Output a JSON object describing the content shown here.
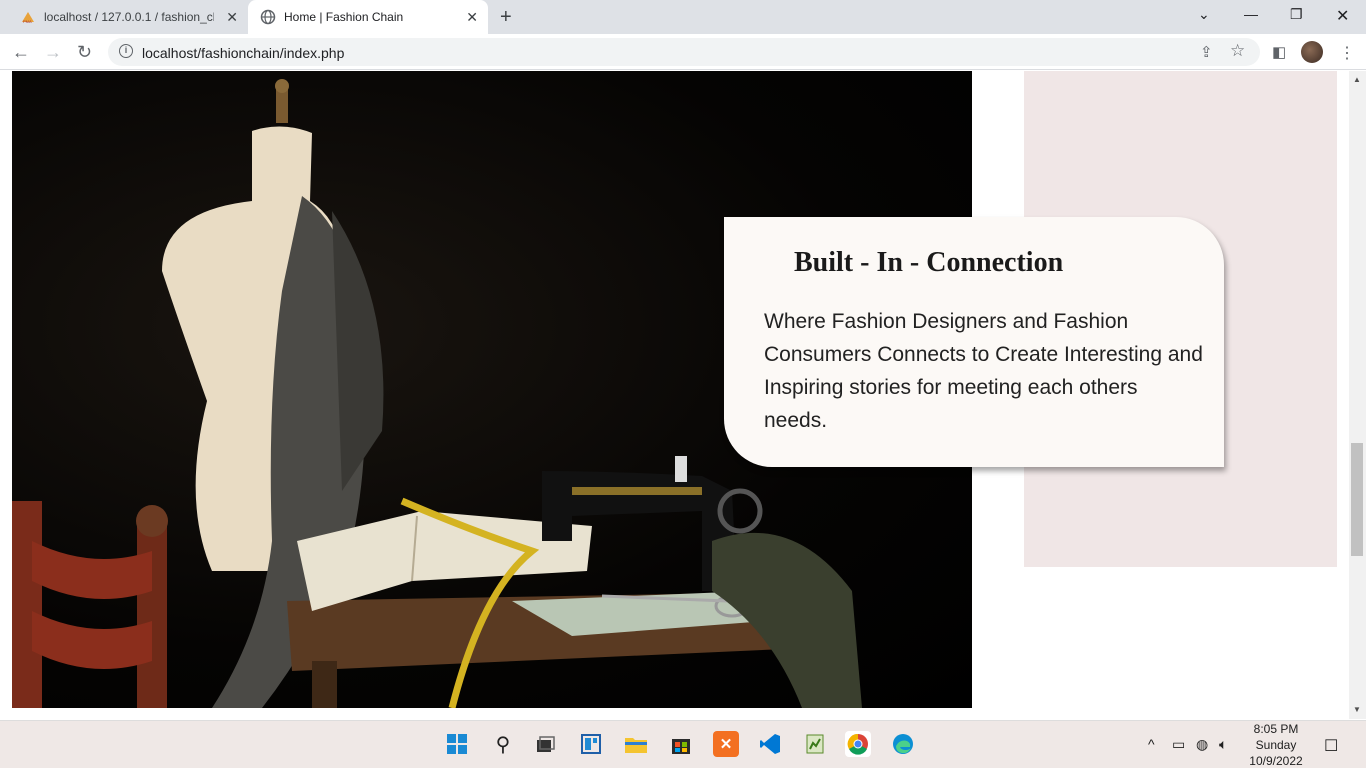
{
  "browser": {
    "tabs": [
      {
        "title": "localhost / 127.0.0.1 / fashion_chain",
        "favicon": "phpmyadmin-icon",
        "active": false
      },
      {
        "title": "Home | Fashion Chain",
        "favicon": "globe-icon",
        "active": true
      }
    ],
    "url": "localhost/fashionchain/index.php"
  },
  "page": {
    "card": {
      "heading": "Built - In - Connection",
      "body": "Where Fashion Designers and Fashion Consumers Connects to Create Interesting and Inspiring stories for meeting each others needs."
    }
  },
  "taskbar": {
    "time": "8:05 PM",
    "day": "Sunday",
    "date": "10/9/2022"
  },
  "colors": {
    "panel": "#f0e6e6",
    "card": "#fcf9f6",
    "taskbar": "#efe8e6"
  }
}
